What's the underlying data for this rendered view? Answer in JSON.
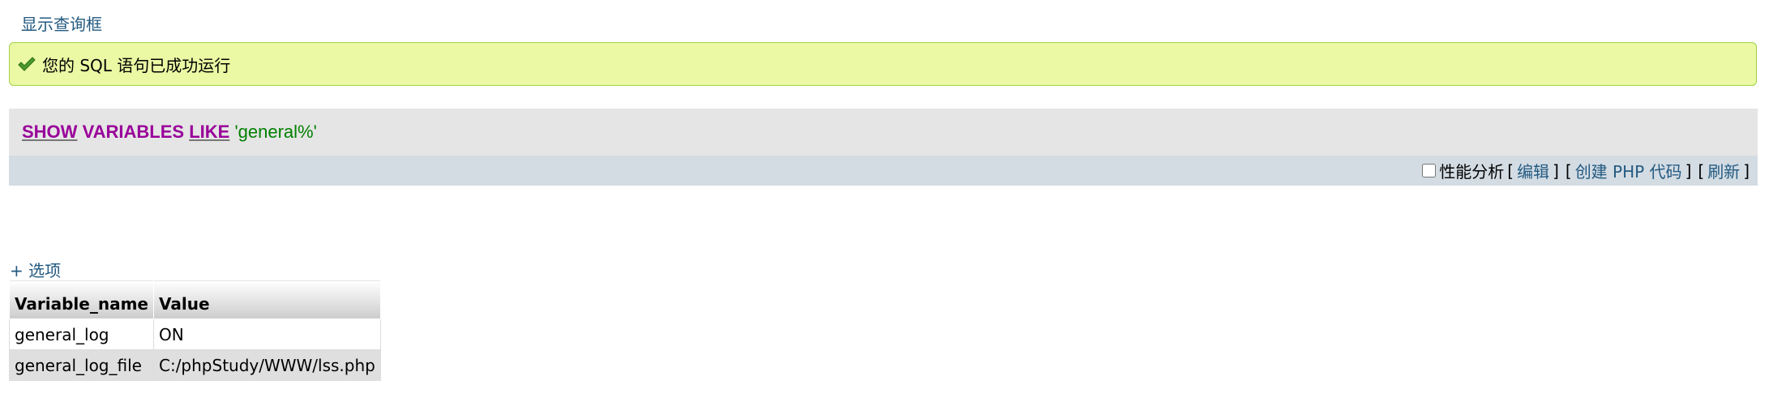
{
  "header": {
    "show_query_link": "显示查询框"
  },
  "success": {
    "message": "您的 SQL 语句已成功运行"
  },
  "query": {
    "kw_show": "SHOW",
    "kw_variables": "VARIABLES",
    "kw_like": "LIKE",
    "string_literal": "'general%'"
  },
  "tools": {
    "profiling_label": "性能分析",
    "edit_label": "编辑",
    "create_php_label": "创建 PHP 代码",
    "refresh_label": "刷新"
  },
  "options": {
    "toggle_label": "+ 选项"
  },
  "results": {
    "columns": [
      "Variable_name",
      "Value"
    ],
    "rows": [
      [
        "general_log",
        "ON"
      ],
      [
        "general_log_file",
        "C:/phpStudy/WWW/lss.php"
      ]
    ]
  },
  "colors": {
    "link": "#235a81",
    "success_bg": "#ebf8a4",
    "keyword": "#990099",
    "string": "#008000",
    "toolbar_bg": "#d3dce3"
  }
}
